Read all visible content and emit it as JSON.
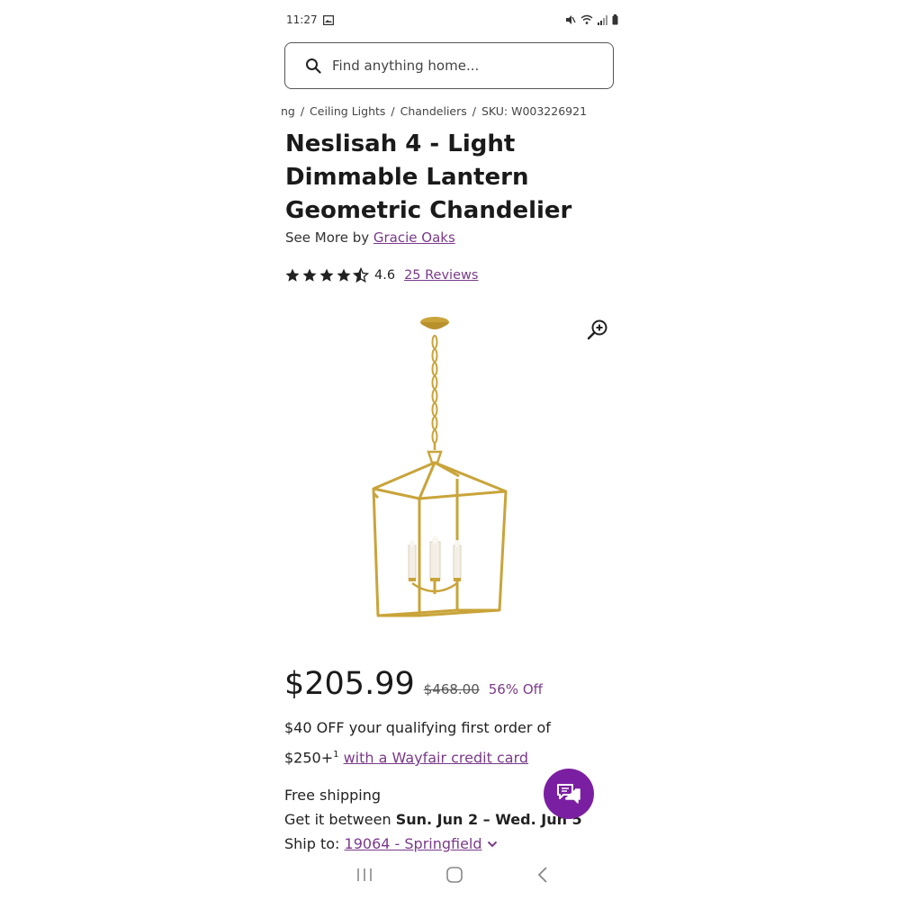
{
  "status_bar": {
    "time": "11:27"
  },
  "search": {
    "placeholder": "Find anything home..."
  },
  "breadcrumb": {
    "items": [
      "ng",
      "Ceiling Lights",
      "Chandeliers",
      "SKU: W003226921"
    ],
    "separator": "/"
  },
  "product": {
    "title": "Neslisah 4 - Light Dimmable Lantern Geometric Chandelier",
    "see_more_prefix": "See More by",
    "brand": "Gracie Oaks",
    "rating": {
      "value": "4.6",
      "stars": 4.5,
      "reviews_label": "25 Reviews"
    }
  },
  "pricing": {
    "price": "$205.99",
    "original_price": "$468.00",
    "discount": "56% Off"
  },
  "promo": {
    "line1": "$40 OFF your qualifying first order of",
    "line2_prefix": "$250+",
    "footnote": "1",
    "link": "with a Wayfair credit card"
  },
  "shipping": {
    "free_shipping": "Free shipping",
    "delivery_prefix": "Get it between",
    "delivery_dates": "Sun. Jun 2 – Wed. Jun 5",
    "ship_to_prefix": "Ship to:",
    "ship_to_location": "19064 - Springfield"
  },
  "icons": {
    "search": "search-icon",
    "zoom": "zoom-in-icon",
    "chat": "chat-icon",
    "star": "star-icon",
    "chevron": "chevron-down-icon"
  },
  "colors": {
    "accent": "#7a3a8a",
    "chat_button": "#7b1fa2",
    "gold": "#c9a43a"
  }
}
